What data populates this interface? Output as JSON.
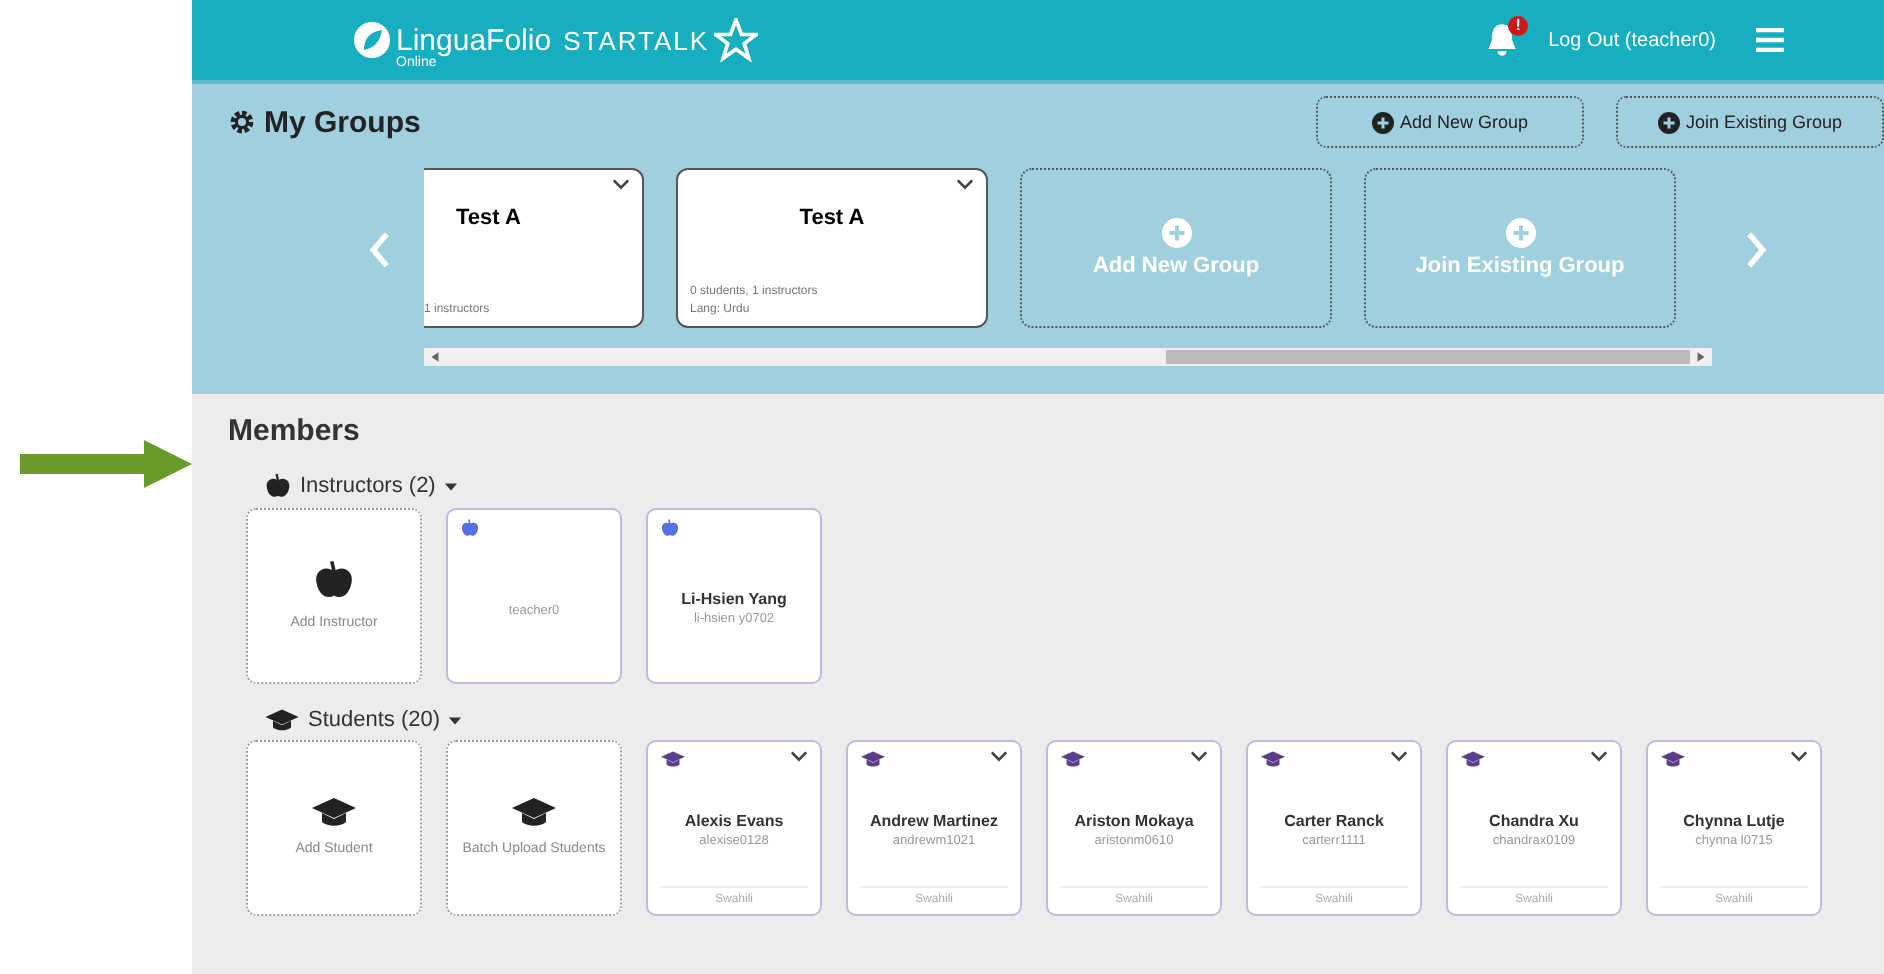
{
  "header": {
    "logo_name": "LinguaFolio",
    "logo_sub": "Online",
    "brand": "STARTALK",
    "notification_badge": "!",
    "logout": "Log Out (teacher0)"
  },
  "groups": {
    "title": "My Groups",
    "actions": [
      "Add New Group",
      "Join Existing Group"
    ],
    "cards": [
      {
        "kind": "group",
        "title": "Test A",
        "lines": [
          "1 instructors"
        ]
      },
      {
        "kind": "group",
        "title": "Test A",
        "lines": [
          "0 students, 1 instructors",
          "Lang: Urdu"
        ]
      },
      {
        "kind": "add",
        "title": "Add New Group"
      },
      {
        "kind": "add",
        "title": "Join Existing Group"
      }
    ]
  },
  "members": {
    "title": "Members",
    "instructors": {
      "label": "Instructors (2)",
      "cards": [
        {
          "kind": "add",
          "label": "Add Instructor"
        },
        {
          "kind": "member",
          "username": "teacher0"
        },
        {
          "kind": "member",
          "name": "Li-Hsien Yang",
          "username": "li-hsien y0702"
        }
      ]
    },
    "students": {
      "label": "Students (20)",
      "cards": [
        {
          "kind": "add",
          "label": "Add Student"
        },
        {
          "kind": "add",
          "label": "Batch Upload Students"
        },
        {
          "kind": "member",
          "name": "Alexis Evans",
          "username": "alexise0128",
          "language": "Swahili"
        },
        {
          "kind": "member",
          "name": "Andrew Martinez",
          "username": "andrewm1021",
          "language": "Swahili"
        },
        {
          "kind": "member",
          "name": "Ariston Mokaya",
          "username": "aristonm0610",
          "language": "Swahili"
        },
        {
          "kind": "member",
          "name": "Carter Ranck",
          "username": "carterr1111",
          "language": "Swahili"
        },
        {
          "kind": "member",
          "name": "Chandra Xu",
          "username": "chandrax0109",
          "language": "Swahili"
        },
        {
          "kind": "member",
          "name": "Chynna Lutje",
          "username": "chynna l0715",
          "language": "Swahili"
        }
      ]
    }
  }
}
